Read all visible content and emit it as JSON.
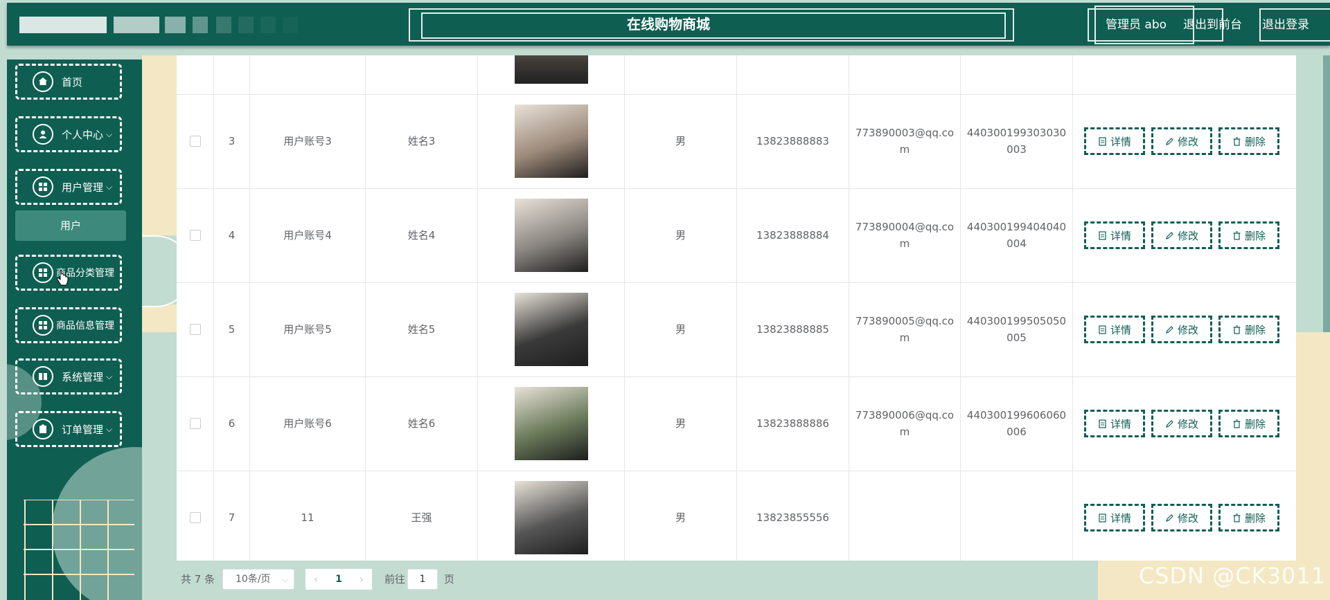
{
  "header": {
    "title": "在线购物商城",
    "admin_label": "管理员 abo",
    "front_link": "退出到前台",
    "logout_link": "退出登录"
  },
  "sidebar": {
    "items": [
      {
        "label": "首页",
        "icon": "home-icon"
      },
      {
        "label": "个人中心",
        "icon": "user-icon"
      },
      {
        "label": "用户管理",
        "icon": "grid-icon"
      },
      {
        "label": "商品分类管理",
        "icon": "grid-icon"
      },
      {
        "label": "商品信息管理",
        "icon": "grid-icon"
      },
      {
        "label": "系统管理",
        "icon": "book-icon"
      },
      {
        "label": "订单管理",
        "icon": "clipboard-icon"
      }
    ],
    "sub_item": "用户"
  },
  "table": {
    "rows": [
      {
        "index": "3",
        "account": "用户账号3",
        "name": "姓名3",
        "gender": "男",
        "phone": "13823888883",
        "email": "773890003@qq.co\nm",
        "idcard": "440300199303030\n003",
        "avatar_tone": "#9c8a7a"
      },
      {
        "index": "4",
        "account": "用户账号4",
        "name": "姓名4",
        "gender": "男",
        "phone": "13823888884",
        "email": "773890004@qq.co\nm",
        "idcard": "440300199404040\n004",
        "avatar_tone": "#8a8580"
      },
      {
        "index": "5",
        "account": "用户账号5",
        "name": "姓名5",
        "gender": "男",
        "phone": "13823888885",
        "email": "773890005@qq.co\nm",
        "idcard": "440300199505050\n005",
        "avatar_tone": "#3a3a3a"
      },
      {
        "index": "6",
        "account": "用户账号6",
        "name": "姓名6",
        "gender": "男",
        "phone": "13823888886",
        "email": "773890006@qq.co\nm",
        "idcard": "440300199606060\n006",
        "avatar_tone": "#6a7a5a"
      },
      {
        "index": "7",
        "account": "11",
        "name": "王强",
        "gender": "男",
        "phone": "13823855556",
        "email": "",
        "idcard": "",
        "avatar_tone": "#555555"
      }
    ],
    "actions": {
      "detail": "详情",
      "edit": "修改",
      "delete": "删除"
    }
  },
  "pager": {
    "total": "共 7 条",
    "page_size": "10条/页",
    "current_page": "1",
    "goto_label": "前往",
    "goto_value": "1",
    "page_unit": "页"
  },
  "watermark": "CSDN @CK3011",
  "colors": {
    "primary": "#0f5e52",
    "background": "#c3dcd2",
    "accent_yellow": "#f3e8c3"
  }
}
